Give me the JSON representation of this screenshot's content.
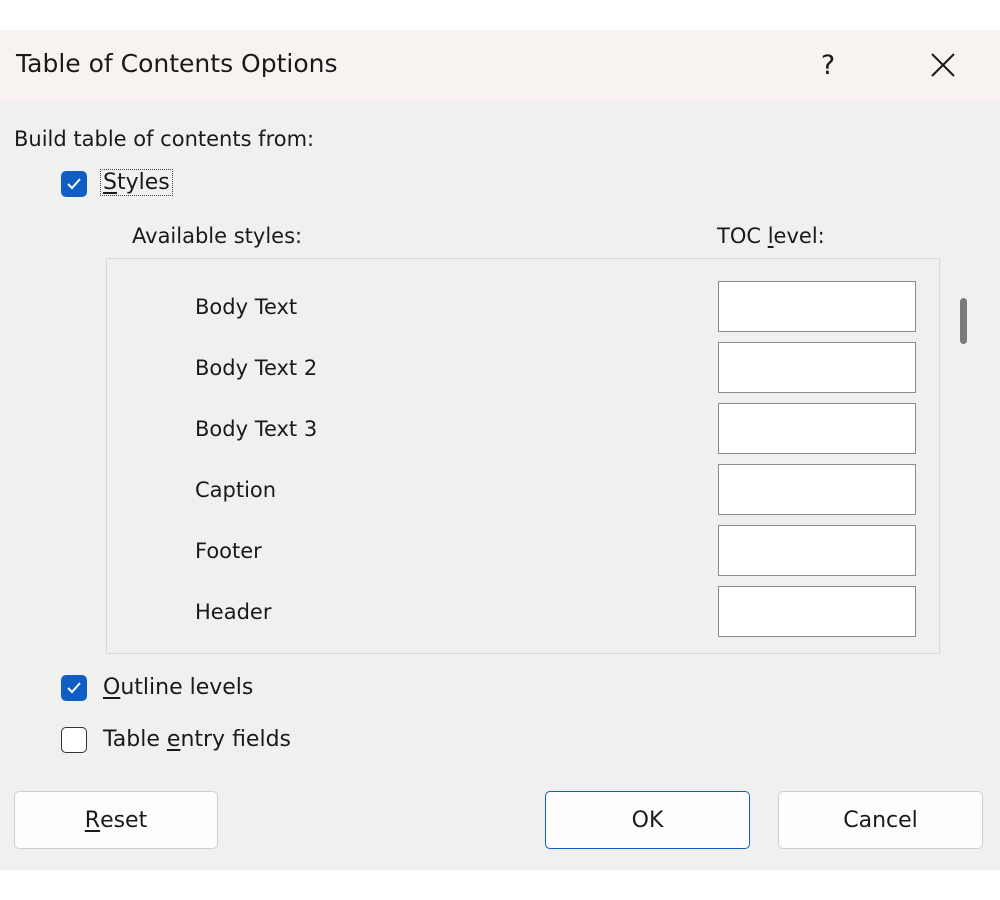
{
  "window": {
    "title": "Table of Contents Options"
  },
  "titlebar": {
    "help_label": "?",
    "close_icon": "close-icon"
  },
  "build": {
    "label": "Build table of contents from:",
    "styles": {
      "checked": true,
      "mnemonic": "S",
      "rest": "tyles"
    },
    "outline": {
      "checked": true,
      "mnemonic": "O",
      "rest": "utline levels"
    },
    "entry_fields": {
      "checked": false,
      "before": "Table ",
      "mnemonic": "e",
      "rest": "ntry fields"
    }
  },
  "columns": {
    "available_styles": "Available styles:",
    "toc_before": "TOC ",
    "toc_mnemonic": "l",
    "toc_rest": "evel:"
  },
  "styles_list": [
    {
      "name": "Body Text",
      "level": ""
    },
    {
      "name": "Body Text 2",
      "level": ""
    },
    {
      "name": "Body Text 3",
      "level": ""
    },
    {
      "name": "Caption",
      "level": ""
    },
    {
      "name": "Footer",
      "level": ""
    },
    {
      "name": "Header",
      "level": ""
    }
  ],
  "buttons": {
    "reset_mnemonic": "R",
    "reset_rest": "eset",
    "ok": "OK",
    "cancel": "Cancel"
  },
  "colors": {
    "accent": "#0f5ec4",
    "dialog_bg": "#f0f0f0",
    "titlebar_bg": "#f8f3f1"
  }
}
